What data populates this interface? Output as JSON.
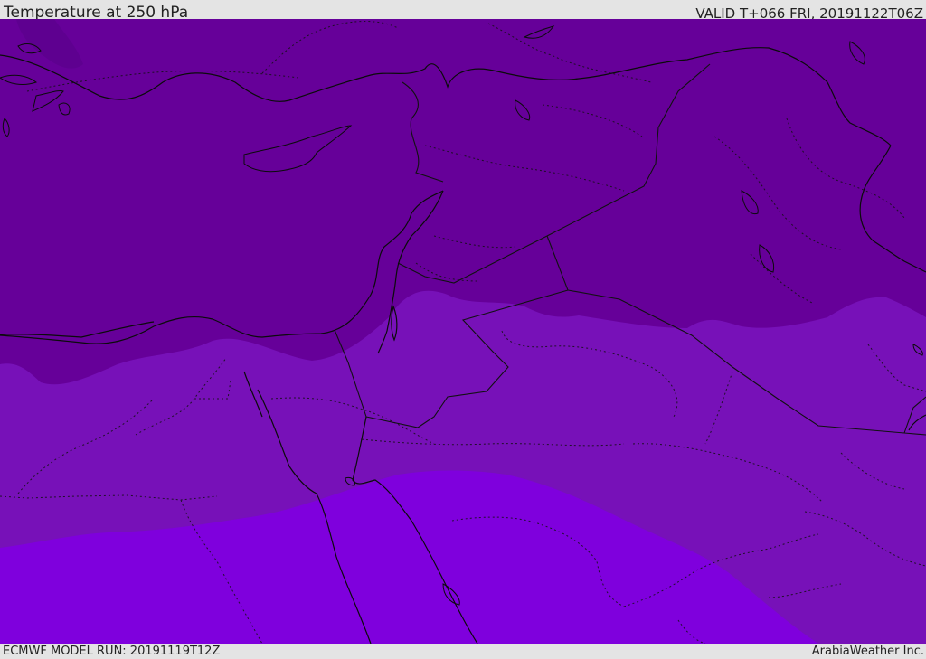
{
  "header": {
    "title": "Temperature at 250 hPa",
    "valid": "VALID T+066 FRI, 20191122T06Z"
  },
  "footer": {
    "model_run": "ECMWF MODEL RUN: 20191119T12Z",
    "credit": "ArabiaWeather Inc."
  },
  "colors": {
    "band_cold": "#660099",
    "band_mid": "#7711b8",
    "band_warm": "#7f00dd",
    "pocket": "#5e0090",
    "lines": "#111111",
    "chrome": "#e4e4e4"
  }
}
